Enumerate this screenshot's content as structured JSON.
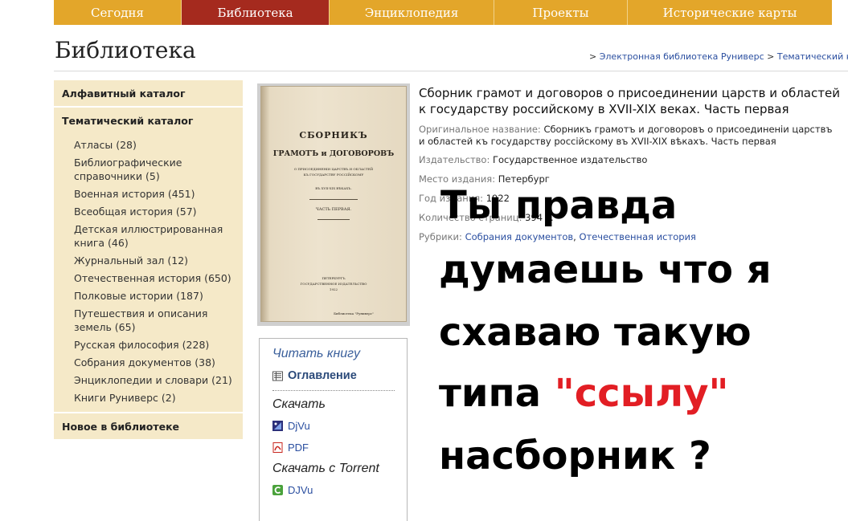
{
  "nav": {
    "tabs": [
      {
        "label": "Сегодня",
        "active": false
      },
      {
        "label": "Библиотека",
        "active": true
      },
      {
        "label": "Энциклопедия",
        "active": false
      },
      {
        "label": "Проекты",
        "active": false
      },
      {
        "label": "Исторические карты",
        "active": false
      }
    ]
  },
  "header": {
    "title": "Библиотека",
    "breadcrumb": {
      "sep": ">",
      "items": [
        "Электронная библиотека Руниверс",
        "Тематический каталог"
      ]
    }
  },
  "sidebar": {
    "alphabetical": "Алфавитный каталог",
    "thematic": "Тематический каталог",
    "items": [
      "Атласы (28)",
      "Библиографические справочники (5)",
      "Военная история (451)",
      "Всеобщая история (57)",
      "Детская иллюстрированная книга (46)",
      "Журнальный зал (12)",
      "Отечественная история (650)",
      "Полковые истории (187)",
      "Путешествия и описания земель (65)",
      "Русская философия (228)",
      "Собрания документов (38)",
      "Энциклопедии и словари (21)",
      "Книги Руниверс (2)"
    ],
    "new": "Новое в библиотеке"
  },
  "cover": {
    "line1": "СБОРНИКЪ",
    "line2": "ГРАМОТЪ и ДОГОВОРОВЪ",
    "line3": "О ПРИСОЕДИНЕНІИ ЦАРСТВЪ И ОБЛАСТЕЙ",
    "line4": "КЪ ГОСУДАРСТВУ РОССІЙСКОМУ",
    "line5": "ВЪ XVII-XIX ВѢКАХЪ.",
    "line6": "ЧАСТЬ ПЕРВАЯ.",
    "line7": "ПЕТЕРБУРГЪ",
    "line8": "ГОСУДАРСТВЕННОЕ ИЗДАТЕЛЬСТВО",
    "line9": "1922",
    "stamp": "Библиотека \"Руниверс\""
  },
  "actions": {
    "read_head": "Читать книгу",
    "contents": "Оглавление",
    "download_head": "Скачать",
    "djvu": "DjVu",
    "pdf": "PDF",
    "torrent_head": "Скачать с Torrent",
    "torrent_djvu": "DJVu"
  },
  "book": {
    "title": "Сборник грамот и договоров о присоединении царств и областей к государству российскому в XVII-XIX веках. Часть первая",
    "orig_label": "Оригинальное название:",
    "orig_value": "Сборникъ грамотъ и договоровъ о присоединеніи царствъ и областей къ государству россійскому въ XVII-XIX вѣкахъ. Часть первая",
    "publisher_label": "Издательство:",
    "publisher_value": "Государственное издательство",
    "place_label": "Место издания:",
    "place_value": "Петербург",
    "year_label": "Год издания:",
    "year_value": "1922",
    "pages_label": "Количество страниц:",
    "pages_value": "394 с.",
    "rubrics_label": "Рубрики:",
    "rubric1": "Собрания документов",
    "rubric_sep": ",",
    "rubric2": "Отечественная история"
  },
  "overlay": {
    "line1": "Ты правда",
    "line2": "думаешь что я",
    "line3": "схаваю такую",
    "line4_prefix": "типа ",
    "line4_red": "\"ссылу\"",
    "line5": "насборник ?",
    "red_color": "#e21e24"
  }
}
